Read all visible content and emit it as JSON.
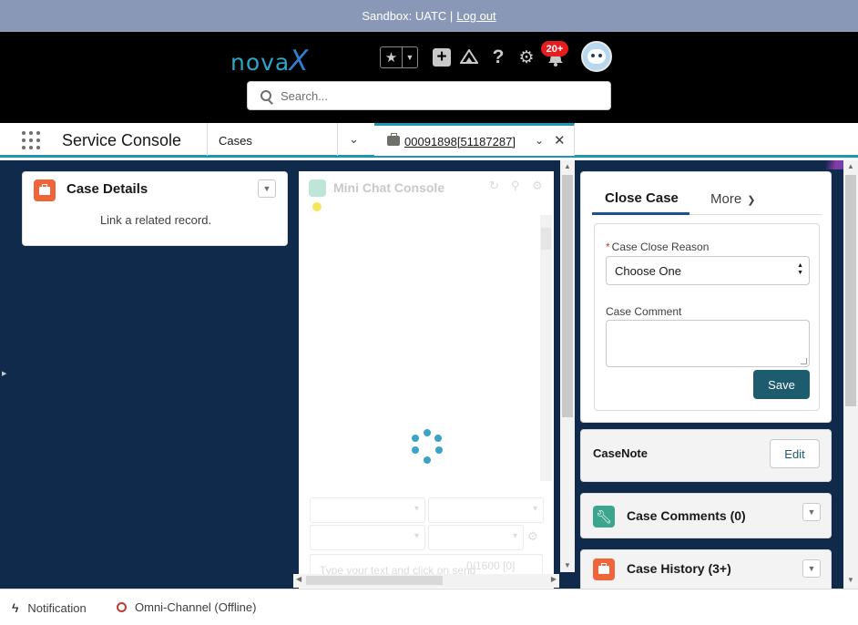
{
  "sandbox_bar": {
    "text": "Sandbox: UATC |",
    "logout": "Log out"
  },
  "header": {
    "logo_text": "nova",
    "logo_x": "X",
    "notification_count": "20+",
    "search": {
      "placeholder": "Search..."
    },
    "icons": [
      "star-icon",
      "chevron-down-icon",
      "plus-icon",
      "trailhead-icon",
      "help-icon",
      "gear-icon",
      "bell-icon",
      "avatar"
    ]
  },
  "nav": {
    "app_name": "Service Console",
    "object_tab": "Cases",
    "active_tab": "00091898[51187287]"
  },
  "case_details": {
    "title": "Case Details",
    "message": "Link a related record."
  },
  "mini_chat": {
    "title": "Mini Chat Console",
    "input_placeholder": "Type your text and click on send",
    "counter": "0/1600 [0]"
  },
  "close_case": {
    "tab_active": "Close Case",
    "tab_more": "More",
    "reason_label": "Case Close Reason",
    "reason_value": "Choose One",
    "comment_label": "Case Comment",
    "save_label": "Save"
  },
  "case_note": {
    "title": "CaseNote",
    "edit_label": "Edit"
  },
  "case_comments": {
    "title": "Case Comments (0)"
  },
  "case_history": {
    "title": "Case History (3+)"
  },
  "footer": {
    "notification": "Notification",
    "omni": "Omni-Channel (Offline)"
  },
  "colors": {
    "workspace": "#102a4c",
    "accent": "#1b96b5",
    "save_button": "#1c5c6e",
    "badge": "#e41e1e"
  }
}
